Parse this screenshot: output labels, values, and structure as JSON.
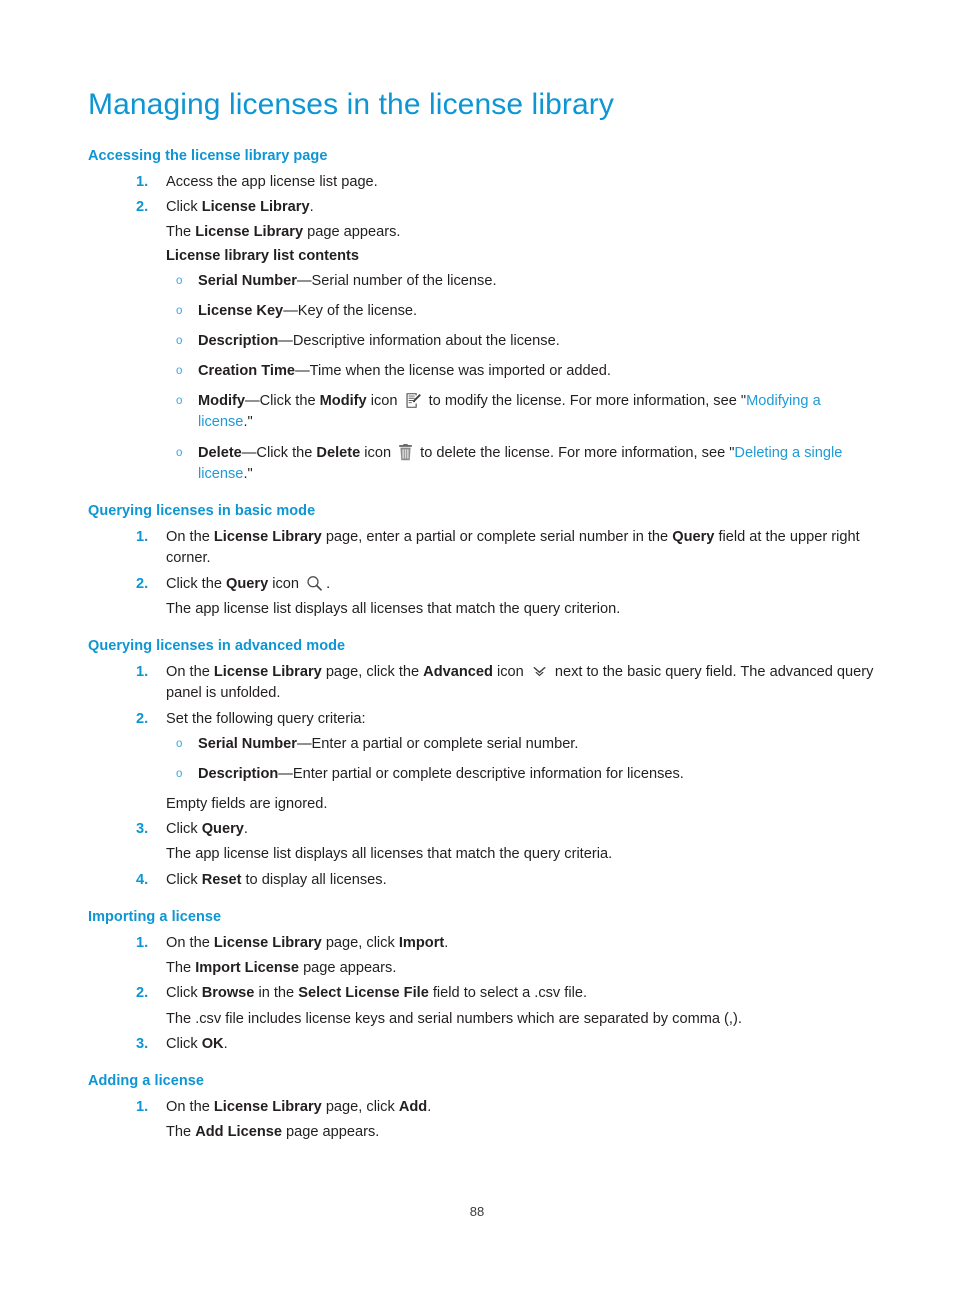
{
  "document": {
    "title": "Managing licenses in the license library",
    "page_number": "88",
    "accent_color": "#0d96d3",
    "link_color": "#1e9ad6",
    "body_color": "#231f20"
  },
  "sections": {
    "accessing": {
      "heading": "Accessing the license library page",
      "step1": {
        "num": "1.",
        "text": "Access the app license list page."
      },
      "step2": {
        "num": "2.",
        "pre": "Click ",
        "bold": "License Library",
        "post": "."
      },
      "appears": {
        "pre": "The ",
        "bold": "License Library",
        "post": " page appears."
      },
      "contents_label": "License library list contents",
      "items": [
        {
          "bullet": "o",
          "term": "Serial Number",
          "dash": "—",
          "desc": "Serial number of the license."
        },
        {
          "bullet": "o",
          "term": "License Key",
          "dash": "—",
          "desc": "Key of the license."
        },
        {
          "bullet": "o",
          "term": "Description",
          "dash": "—",
          "desc": "Descriptive information about the license."
        },
        {
          "bullet": "o",
          "term": "Creation Time",
          "dash": "—",
          "desc": "Time when the license was imported or added."
        }
      ],
      "modify_item": {
        "bullet": "o",
        "term": "Modify",
        "dash": "—",
        "pre": "Click the ",
        "bold": "Modify",
        "mid": " icon ",
        "icon": "modify-icon",
        "after": " to modify the license. For more information, see \"",
        "link": "Modifying a license",
        "end": ".\""
      },
      "delete_item": {
        "bullet": "o",
        "term": "Delete",
        "dash": "—",
        "pre": "Click the ",
        "bold": "Delete",
        "mid": " icon ",
        "icon": "trash-icon",
        "after": " to delete the license. For more information, see \"",
        "link": "Deleting a single license",
        "end": ".\""
      }
    },
    "basic_query": {
      "heading": "Querying licenses in basic mode",
      "step1": {
        "num": "1.",
        "pre": "On the ",
        "bold1": "License Library",
        "mid": " page, enter a partial or complete serial number in the ",
        "bold2": "Query",
        "post": " field at the upper right corner."
      },
      "step2": {
        "num": "2.",
        "pre": "Click the ",
        "bold": "Query",
        "mid": " icon ",
        "icon": "search-icon",
        "post": "."
      },
      "result": "The app license list displays all licenses that match the query criterion."
    },
    "advanced_query": {
      "heading": "Querying licenses in advanced mode",
      "step1": {
        "num": "1.",
        "pre": "On the ",
        "bold1": "License Library",
        "mid": " page, click the ",
        "bold2": "Advanced",
        "mid2": " icon ",
        "icon": "chevron-double-down-icon",
        "post": " next to the basic query field. The advanced query panel is unfolded."
      },
      "step2": {
        "num": "2.",
        "text": "Set the following query criteria:"
      },
      "criteria": [
        {
          "bullet": "o",
          "term": "Serial Number",
          "dash": "—",
          "desc": "Enter a partial or complete serial number."
        },
        {
          "bullet": "o",
          "term": "Description",
          "dash": "—",
          "desc": "Enter partial or complete descriptive information for licenses."
        }
      ],
      "empty_note": "Empty fields are ignored.",
      "step3": {
        "num": "3.",
        "pre": "Click ",
        "bold": "Query",
        "post": "."
      },
      "step3_result": "The app license list displays all licenses that match the query criteria.",
      "step4": {
        "num": "4.",
        "pre": "Click ",
        "bold": "Reset",
        "post": " to display all licenses."
      }
    },
    "importing": {
      "heading": "Importing a license",
      "step1": {
        "num": "1.",
        "pre": "On the ",
        "bold1": "License Library",
        "mid": " page, click ",
        "bold2": "Import",
        "post": "."
      },
      "step1_result": {
        "pre": "The ",
        "bold": "Import License",
        "post": " page appears."
      },
      "step2": {
        "num": "2.",
        "pre": "Click ",
        "bold1": "Browse",
        "mid": " in the ",
        "bold2": "Select License File",
        "post": " field to select a .csv file."
      },
      "step2_result": "The .csv file includes license keys and serial numbers which are separated by comma (,).",
      "step3": {
        "num": "3.",
        "pre": "Click ",
        "bold": "OK",
        "post": "."
      }
    },
    "adding": {
      "heading": "Adding a license",
      "step1": {
        "num": "1.",
        "pre": "On the ",
        "bold1": "License Library",
        "mid": " page, click ",
        "bold2": "Add",
        "post": "."
      },
      "step1_result": {
        "pre": "The ",
        "bold": "Add License",
        "post": " page appears."
      }
    }
  }
}
